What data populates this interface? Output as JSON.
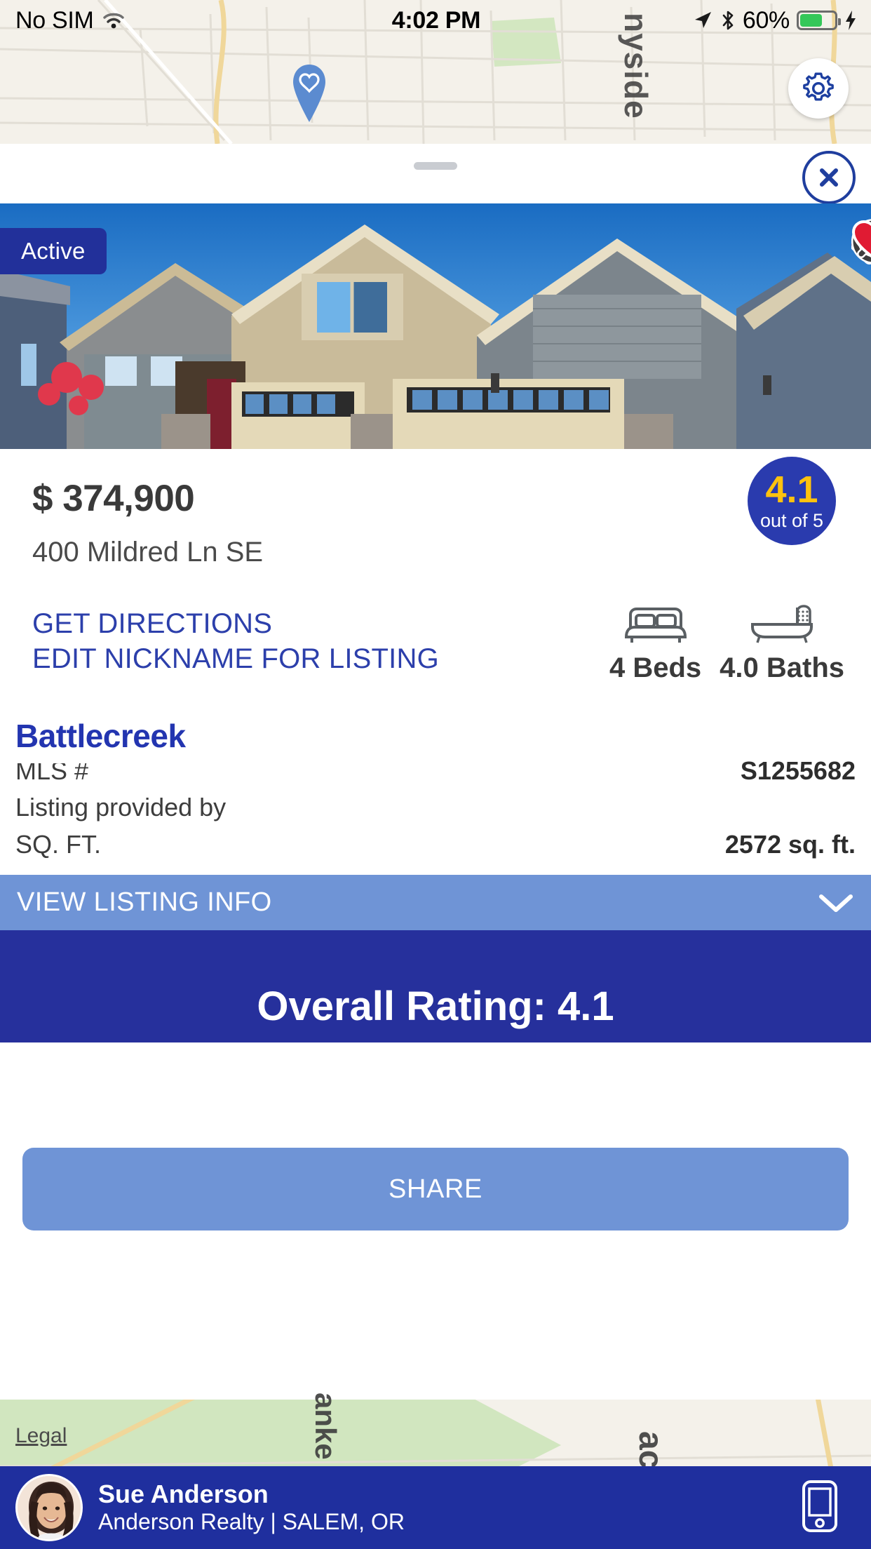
{
  "status_bar": {
    "carrier": "No SIM",
    "wifi_icon": "wifi-icon",
    "time": "4:02 PM",
    "location_icon": "location-arrow-icon",
    "bluetooth_icon": "bluetooth-icon",
    "battery_percent": "60%",
    "battery_icon": "battery-icon",
    "charging_icon": "charging-bolt-icon"
  },
  "map": {
    "pin_icon": "heart-map-pin-icon",
    "settings_icon": "gear-icon",
    "road_label": "nyside",
    "legal_label": "Legal",
    "label_parkway": "anke",
    "label_pacific": "acif"
  },
  "sheet": {
    "drag_handle": "drag-handle",
    "close_icon": "close-x-icon"
  },
  "listing": {
    "status_badge": "Active",
    "photo_actions": {
      "check_icon": "red-check-icon",
      "reject_icon": "no-entry-icon",
      "favorite_icon": "red-heart-icon"
    },
    "nickname": "Battlecreek",
    "price": "$ 374,900",
    "address": "400 Mildred Ln SE",
    "rating": {
      "value": "4.1",
      "out_of": "out of 5"
    },
    "links": {
      "directions": "GET DIRECTIONS",
      "edit_nickname": "EDIT NICKNAME FOR LISTING"
    },
    "features": [
      {
        "icon": "bed-icon",
        "label": "4 Beds"
      },
      {
        "icon": "bathtub-icon",
        "label": "4.0 Baths"
      }
    ],
    "details": [
      {
        "key": "MLS #",
        "value": "S1255682"
      },
      {
        "key": "Listing provided by",
        "value": ""
      },
      {
        "key": "SQ. FT.",
        "value": "2572 sq. ft."
      }
    ],
    "view_listing_info": {
      "label": "VIEW LISTING INFO",
      "chevron_icon": "chevron-down-icon"
    },
    "overall_rating_title": "Overall Rating: 4.1",
    "share_label": "SHARE"
  },
  "agent": {
    "avatar": "agent-avatar",
    "name": "Sue Anderson",
    "company_location": "Anderson Realty | SALEM, OR",
    "phone_icon": "mobile-phone-icon"
  },
  "colors": {
    "brand_dark_blue": "#1f2f9e",
    "brand_blue": "#2a3bae",
    "light_blue": "#6f94d6",
    "accent_gold": "#ffc20e",
    "red": "#e01b33"
  }
}
